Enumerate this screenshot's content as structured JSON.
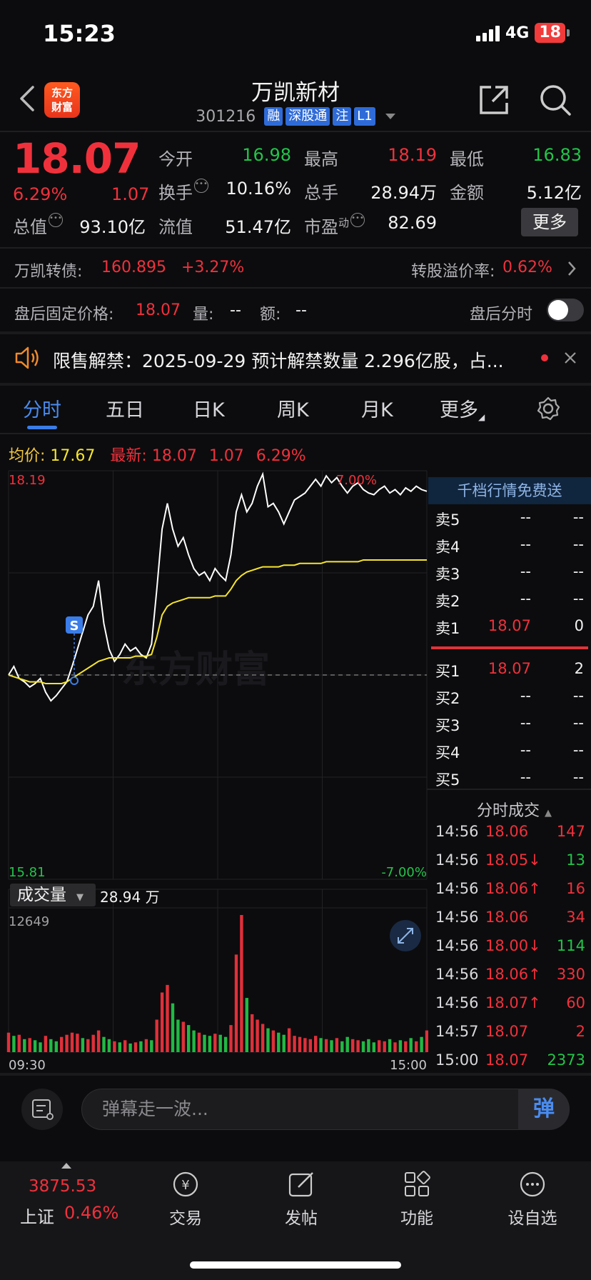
{
  "status_bar": {
    "time": "15:23",
    "network": "4G",
    "battery": "18"
  },
  "header": {
    "logo_line1": "东方",
    "logo_line2": "财富",
    "stock_name": "万凯新材",
    "stock_code": "301216",
    "tags": [
      "融",
      "深股通",
      "注",
      "L1"
    ]
  },
  "quote": {
    "last_price": "18.07",
    "pct_change": "6.29%",
    "abs_change": "1.07",
    "fields": [
      {
        "label": "今开",
        "value": "16.98",
        "color": "green"
      },
      {
        "label": "最高",
        "value": "18.19",
        "color": "red"
      },
      {
        "label": "最低",
        "value": "16.83",
        "color": "green"
      },
      {
        "label": "换手",
        "value": "10.16%",
        "color": "white"
      },
      {
        "label": "总手",
        "value": "28.94万",
        "color": "white"
      },
      {
        "label": "金额",
        "value": "5.12亿",
        "color": "white"
      },
      {
        "label": "总值",
        "value": "93.10亿",
        "color": "white"
      },
      {
        "label": "流值",
        "value": "51.47亿",
        "color": "white"
      },
      {
        "label": "市盈",
        "sup": "动",
        "value": "82.69",
        "color": "white"
      }
    ],
    "more_label": "更多"
  },
  "bond": {
    "label": "万凯转债:",
    "price": "160.895",
    "change": "+3.27%",
    "premium_label": "转股溢价率:",
    "premium": "0.62%"
  },
  "after_hours": {
    "label": "盘后固定价格:",
    "price": "18.07",
    "vol_label": "量:",
    "vol": "--",
    "amt_label": "额:",
    "amt": "--",
    "toggle_label": "盘后分时",
    "toggle_on": false
  },
  "notice": {
    "text": "限售解禁：2025-09-29 预计解禁数量 2.296亿股，占..."
  },
  "tabs": [
    {
      "label": "分时",
      "active": true
    },
    {
      "label": "五日",
      "active": false
    },
    {
      "label": "日K",
      "active": false
    },
    {
      "label": "周K",
      "active": false
    },
    {
      "label": "月K",
      "active": false
    },
    {
      "label": "更多",
      "active": false
    }
  ],
  "avg_row": {
    "avg_label": "均价:",
    "avg": "17.67",
    "latest_label": "最新:",
    "latest": "18.07",
    "chg": "1.07",
    "pct": "6.29%"
  },
  "chart_axis": {
    "y_max": "18.19",
    "y_min": "15.81",
    "pct_max": "7.00%",
    "pct_min": "-7.00%",
    "vol_max": "12649",
    "x_start": "09:30",
    "x_end": "15:00",
    "marker": "S",
    "watermark": "东方财富"
  },
  "chart_data": {
    "type": "line",
    "ylim": [
      15.81,
      18.19
    ],
    "prev_close": 17.0,
    "series": [
      {
        "values": [
          17.0,
          17.05,
          16.98,
          16.96,
          16.93,
          16.95,
          16.98,
          16.9,
          16.85,
          16.88,
          16.92,
          16.96,
          17.05,
          17.15,
          17.25,
          17.35,
          17.4,
          17.55,
          17.3,
          17.15,
          17.08,
          17.12,
          17.18,
          17.14,
          17.16,
          17.12,
          17.1,
          17.18,
          17.5,
          17.85,
          18.0,
          17.85,
          17.75,
          17.8,
          17.7,
          17.62,
          17.58,
          17.6,
          17.55,
          17.62,
          17.58,
          17.55,
          17.7,
          17.95,
          18.05,
          17.95,
          18.0,
          18.1,
          18.17,
          17.98,
          18.0,
          17.95,
          17.88,
          17.95,
          18.02,
          18.04,
          18.06,
          18.1,
          18.14,
          18.1,
          18.16,
          18.12,
          18.15,
          18.1,
          18.06,
          18.1,
          18.12,
          18.08,
          18.06,
          18.05,
          18.08,
          18.1,
          18.06,
          18.08,
          18.05,
          18.09,
          18.07,
          18.1,
          18.08,
          18.07
        ]
      },
      {
        "values": [
          17.0,
          16.99,
          16.98,
          16.97,
          16.96,
          16.96,
          16.96,
          16.95,
          16.95,
          16.95,
          16.95,
          16.96,
          16.98,
          17.0,
          17.02,
          17.04,
          17.06,
          17.08,
          17.09,
          17.1,
          17.1,
          17.1,
          17.1,
          17.1,
          17.11,
          17.11,
          17.11,
          17.12,
          17.22,
          17.35,
          17.4,
          17.42,
          17.43,
          17.44,
          17.45,
          17.45,
          17.45,
          17.45,
          17.45,
          17.46,
          17.46,
          17.46,
          17.5,
          17.55,
          17.58,
          17.6,
          17.61,
          17.62,
          17.63,
          17.63,
          17.63,
          17.63,
          17.64,
          17.64,
          17.64,
          17.65,
          17.65,
          17.65,
          17.65,
          17.65,
          17.66,
          17.66,
          17.66,
          17.66,
          17.66,
          17.66,
          17.66,
          17.67,
          17.67,
          17.67,
          17.67,
          17.67,
          17.67,
          17.67,
          17.67,
          17.67,
          17.67,
          17.67,
          17.67,
          17.67
        ]
      }
    ],
    "volume": [
      1800,
      1500,
      1600,
      1200,
      1300,
      1100,
      900,
      1500,
      1200,
      1000,
      1400,
      1600,
      1800,
      1700,
      1300,
      1200,
      1600,
      2000,
      1400,
      1200,
      1000,
      900,
      1100,
      800,
      900,
      1000,
      1200,
      1100,
      3000,
      5500,
      6200,
      4500,
      3000,
      2800,
      2500,
      2000,
      1800,
      1600,
      1500,
      1700,
      1600,
      1400,
      2500,
      9000,
      12649,
      5000,
      3500,
      3000,
      2600,
      2200,
      2000,
      1800,
      1600,
      2200,
      1500,
      1400,
      1300,
      1200,
      1500,
      1300,
      1200,
      1100,
      1300,
      1000,
      1400,
      1200,
      1100,
      1000,
      1200,
      900,
      1100,
      1000,
      1200,
      900,
      1100,
      1000,
      1300,
      1000,
      1400,
      2000
    ],
    "volume_up": [
      true,
      false,
      true,
      false,
      true,
      false,
      false,
      true,
      false,
      false,
      true,
      true,
      true,
      true,
      false,
      true,
      true,
      true,
      false,
      false,
      true,
      false,
      true,
      false,
      true,
      false,
      true,
      false,
      true,
      true,
      true,
      false,
      false,
      true,
      false,
      false,
      true,
      false,
      false,
      true,
      false,
      false,
      true,
      true,
      true,
      false,
      true,
      true,
      true,
      false,
      true,
      false,
      false,
      true,
      true,
      true,
      true,
      true,
      true,
      false,
      true,
      false,
      true,
      false,
      false,
      true,
      true,
      false,
      false,
      false,
      true,
      true,
      false,
      true,
      false,
      true,
      false,
      true,
      false,
      true
    ]
  },
  "order_book": {
    "header": "千档行情免费送",
    "asks": [
      {
        "label": "卖5",
        "price": "--",
        "vol": "--"
      },
      {
        "label": "卖4",
        "price": "--",
        "vol": "--"
      },
      {
        "label": "卖3",
        "price": "--",
        "vol": "--"
      },
      {
        "label": "卖2",
        "price": "--",
        "vol": "--"
      },
      {
        "label": "卖1",
        "price": "18.07",
        "vol": "0"
      }
    ],
    "bids": [
      {
        "label": "买1",
        "price": "18.07",
        "vol": "2"
      },
      {
        "label": "买2",
        "price": "--",
        "vol": "--"
      },
      {
        "label": "买3",
        "price": "--",
        "vol": "--"
      },
      {
        "label": "买4",
        "price": "--",
        "vol": "--"
      },
      {
        "label": "买5",
        "price": "--",
        "vol": "--"
      }
    ]
  },
  "trades": {
    "title": "分时成交",
    "rows": [
      {
        "time": "14:56",
        "price": "18.06",
        "arrow": "",
        "vol": "147",
        "vol_color": "red"
      },
      {
        "time": "14:56",
        "price": "18.05",
        "arrow": "↓",
        "vol": "13",
        "vol_color": "green"
      },
      {
        "time": "14:56",
        "price": "18.06",
        "arrow": "↑",
        "vol": "16",
        "vol_color": "red"
      },
      {
        "time": "14:56",
        "price": "18.06",
        "arrow": "",
        "vol": "34",
        "vol_color": "red"
      },
      {
        "time": "14:56",
        "price": "18.00",
        "arrow": "↓",
        "vol": "114",
        "vol_color": "green"
      },
      {
        "time": "14:56",
        "price": "18.06",
        "arrow": "↑",
        "vol": "330",
        "vol_color": "red"
      },
      {
        "time": "14:56",
        "price": "18.07",
        "arrow": "↑",
        "vol": "60",
        "vol_color": "red"
      },
      {
        "time": "14:57",
        "price": "18.07",
        "arrow": "",
        "vol": "2",
        "vol_color": "red"
      },
      {
        "time": "15:00",
        "price": "18.07",
        "arrow": "",
        "vol": "2373",
        "vol_color": "green"
      }
    ]
  },
  "volume_panel": {
    "label": "成交量",
    "total": "28.94 万"
  },
  "danmu": {
    "placeholder": "弹幕走一波...",
    "button": "弹"
  },
  "bottom_nav": {
    "index_value": "3875.53",
    "index_name": "上证",
    "index_pct": "0.46%",
    "items": [
      "交易",
      "发帖",
      "功能",
      "设自选"
    ]
  }
}
